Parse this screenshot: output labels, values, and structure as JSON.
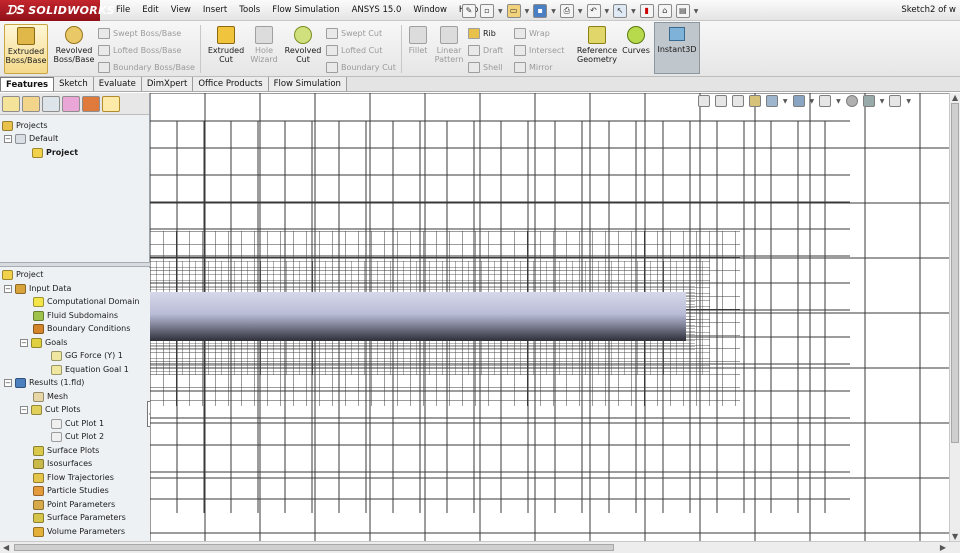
{
  "app": {
    "name": "SOLIDWORKS",
    "document_title": "Sketch2 of w"
  },
  "menu": [
    "File",
    "Edit",
    "View",
    "Insert",
    "Tools",
    "Flow Simulation",
    "ANSYS 15.0",
    "Window",
    "Help"
  ],
  "ribbon": {
    "extruded_boss": "Extruded Boss/Base",
    "revolved_boss": "Revolved Boss/Base",
    "swept_boss": "Swept Boss/Base",
    "lofted_boss": "Lofted Boss/Base",
    "boundary_boss": "Boundary Boss/Base",
    "extruded_cut": "Extruded Cut",
    "hole_wizard": "Hole Wizard",
    "revolved_cut": "Revolved Cut",
    "swept_cut": "Swept Cut",
    "lofted_cut": "Lofted Cut",
    "boundary_cut": "Boundary Cut",
    "fillet": "Fillet",
    "linear_pattern": "Linear Pattern",
    "rib": "Rib",
    "draft": "Draft",
    "shell": "Shell",
    "wrap": "Wrap",
    "intersect": "Intersect",
    "mirror": "Mirror",
    "reference_geometry": "Reference Geometry",
    "curves": "Curves",
    "instant3d": "Instant3D"
  },
  "tabs": [
    "Features",
    "Sketch",
    "Evaluate",
    "DimXpert",
    "Office Products",
    "Flow Simulation"
  ],
  "upper_tree": {
    "projects": "Projects",
    "default": "Default",
    "project": "Project"
  },
  "lower_tree": {
    "project": "Project",
    "input_data": "Input Data",
    "computational_domain": "Computational Domain",
    "fluid_subdomains": "Fluid Subdomains",
    "boundary_conditions": "Boundary Conditions",
    "goals": "Goals",
    "gg_force": "GG Force (Y) 1",
    "equation_goal": "Equation Goal 1",
    "results": "Results (1.fld)",
    "mesh": "Mesh",
    "cut_plots": "Cut Plots",
    "cut_plot_1": "Cut Plot 1",
    "cut_plot_2": "Cut Plot 2",
    "surface_plots": "Surface Plots",
    "isosurfaces": "Isosurfaces",
    "flow_trajectories": "Flow Trajectories",
    "particle_studies": "Particle Studies",
    "point_parameters": "Point Parameters",
    "surface_parameters": "Surface Parameters",
    "volume_parameters": "Volume Parameters"
  },
  "colors": {
    "logo_red": "#b01c24",
    "mesh_line": "#3a3a3a",
    "body_top": "#c7cadf",
    "body_bottom": "#34353f"
  }
}
